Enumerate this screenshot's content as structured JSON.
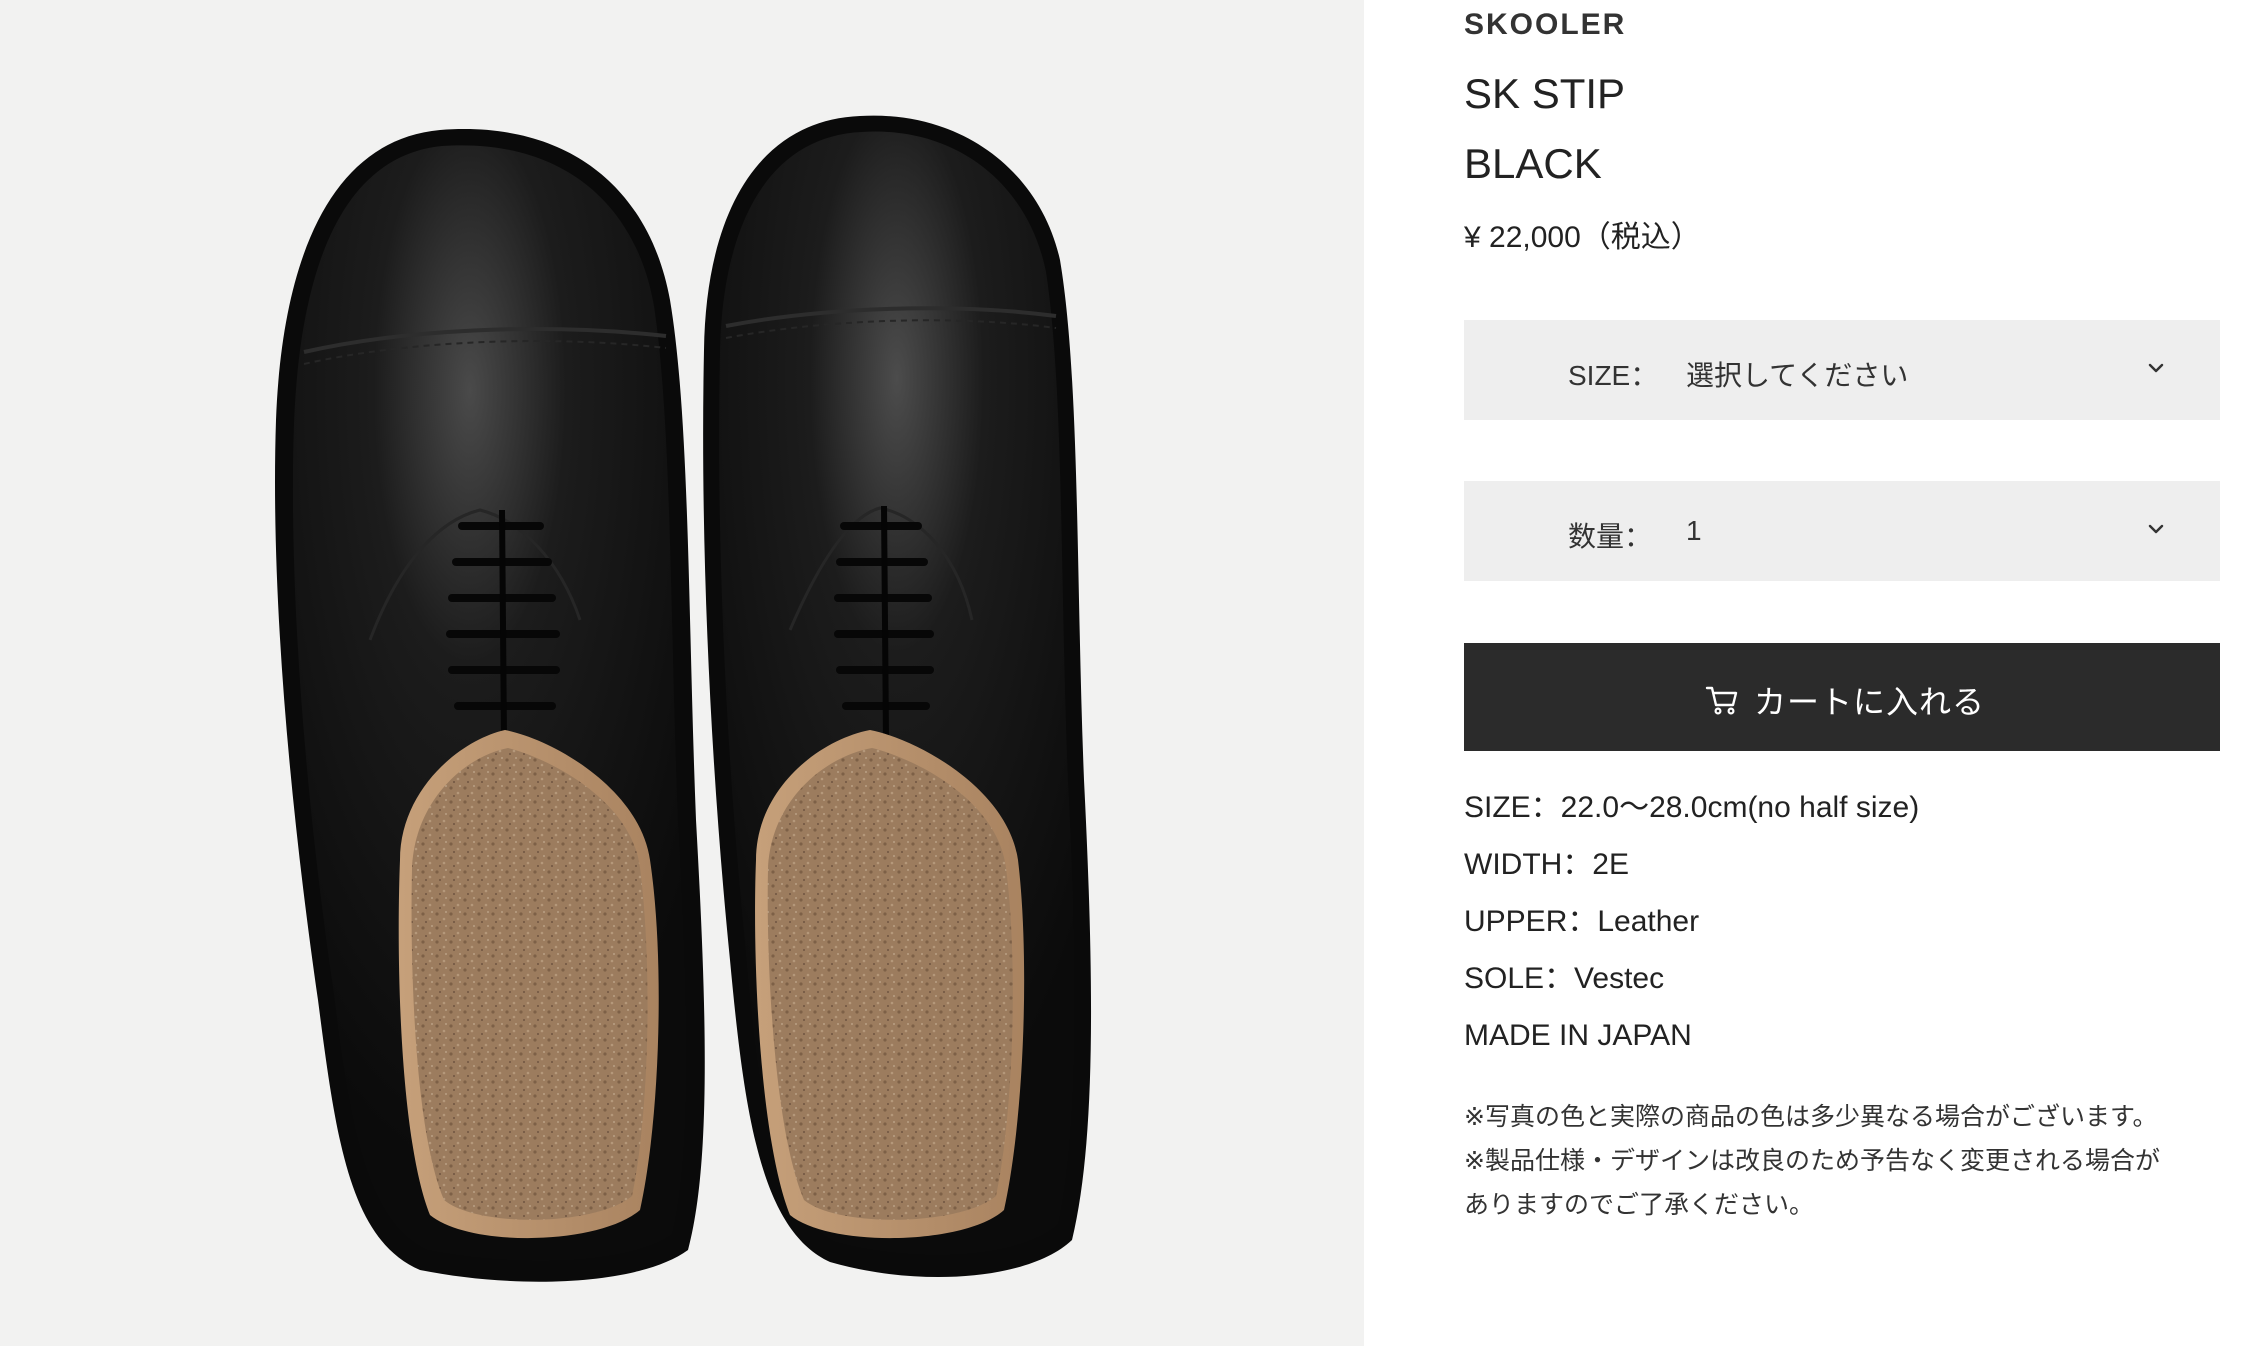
{
  "product": {
    "brand": "SKOOLER",
    "name": "SK STIP",
    "color_name": "BLACK",
    "price": "¥ 22,000（税込）"
  },
  "options": {
    "size": {
      "label": "SIZE：",
      "value": "選択してください"
    },
    "quantity": {
      "label": "数量：",
      "value": "1"
    }
  },
  "cart_button": {
    "label": "カートに入れる",
    "icon": "cart-icon"
  },
  "specs": [
    "SIZE：22.0〜28.0cm(no half size)",
    "WIDTH：2E",
    "UPPER：Leather",
    "SOLE：Vestec",
    "MADE IN JAPAN"
  ],
  "notes": [
    "※写真の色と実際の商品の色は多少異なる場合がございます。",
    "※製品仕様・デザインは改良のため予告なく変更される場合が",
    "ありますのでご了承ください。"
  ],
  "colors": {
    "button_bg": "#2b2b2b",
    "select_bg": "#eeeeee",
    "photo_bg": "#f2f2f1",
    "leather": "#141414",
    "cork": "#9a7a5c"
  }
}
